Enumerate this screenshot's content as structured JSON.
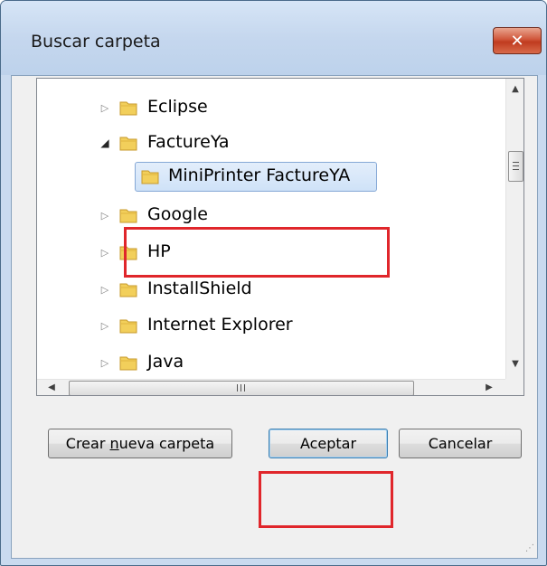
{
  "dialog": {
    "title": "Buscar carpeta",
    "close_glyph": "✕"
  },
  "tree": {
    "items": [
      {
        "label": "Eclipse",
        "expander": "▷"
      },
      {
        "label": "FactureYa",
        "expander": "◢"
      },
      {
        "label": "MiniPrinter FactureYA",
        "expander": ""
      },
      {
        "label": "Google",
        "expander": "▷"
      },
      {
        "label": "HP",
        "expander": "▷"
      },
      {
        "label": "InstallShield",
        "expander": "▷"
      },
      {
        "label": "Internet Explorer",
        "expander": "▷"
      },
      {
        "label": "Java",
        "expander": "▷"
      }
    ],
    "selected_label": "MiniPrinter FactureYA"
  },
  "scrollbar": {
    "up": "▲",
    "down": "▼",
    "left": "◀",
    "right": "▶"
  },
  "buttons": {
    "new_folder_prefix": "Crear ",
    "new_folder_mnemonic": "n",
    "new_folder_suffix": "ueva carpeta",
    "ok": "Aceptar",
    "cancel": "Cancelar"
  },
  "colors": {
    "highlight": "#e0262b",
    "folder": "#f2cf5b"
  }
}
